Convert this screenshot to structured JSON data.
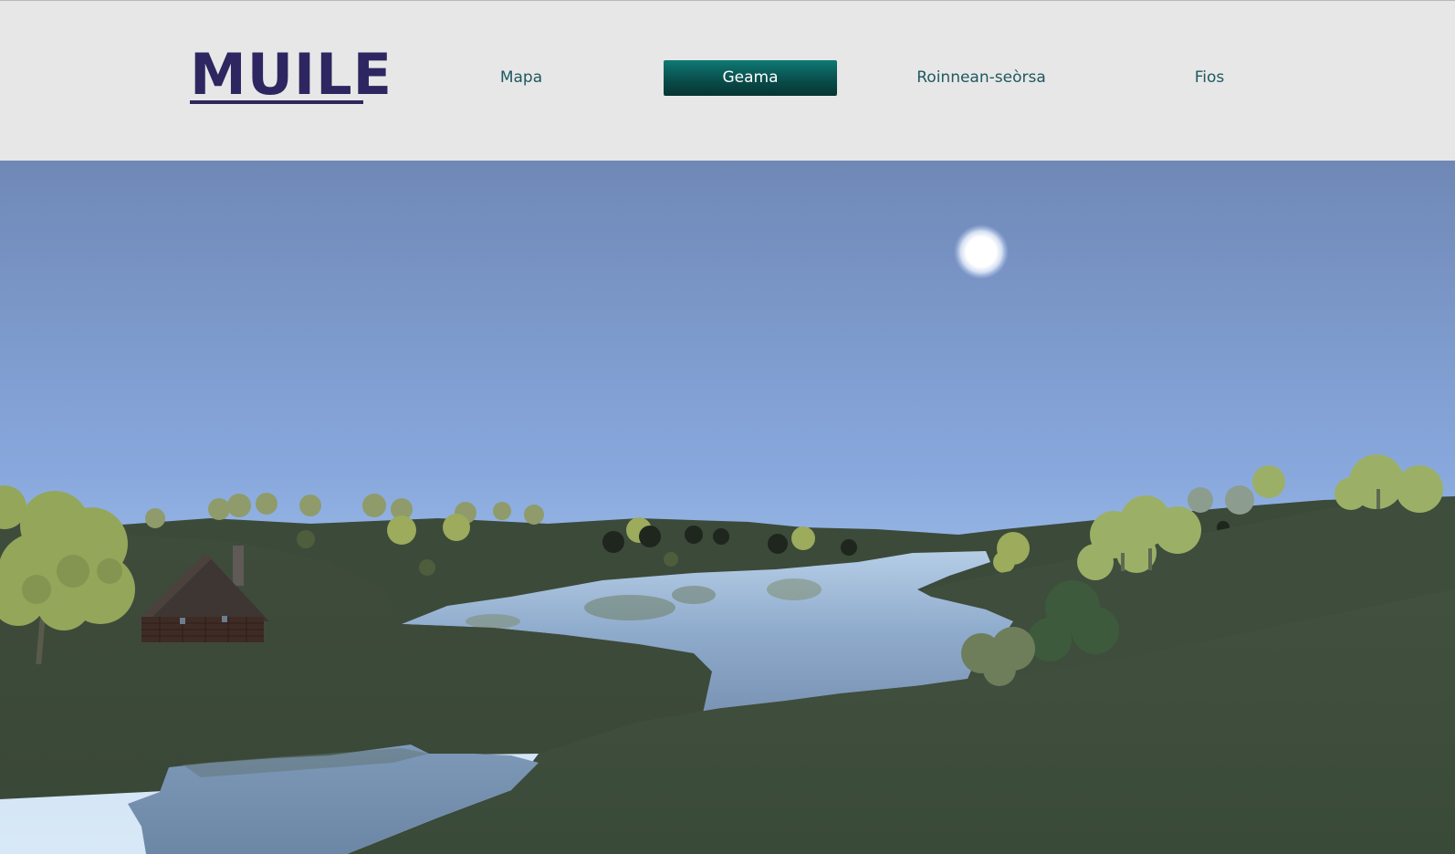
{
  "header": {
    "logo_text": "MUILE",
    "nav": [
      {
        "label": "Mapa",
        "active": false
      },
      {
        "label": "Geama",
        "active": true
      },
      {
        "label": "Roinnean-seòrsa",
        "active": false
      },
      {
        "label": "Fios",
        "active": false
      }
    ]
  },
  "colors": {
    "header_bg": "#e7e7e7",
    "logo": "#2e2660",
    "nav_text": "#1e5860",
    "active_button": "#0a4f4d",
    "active_text": "#ffffff"
  },
  "scene": {
    "description_icons": [
      "sun-icon",
      "house-icon",
      "tree-icon",
      "river"
    ]
  }
}
